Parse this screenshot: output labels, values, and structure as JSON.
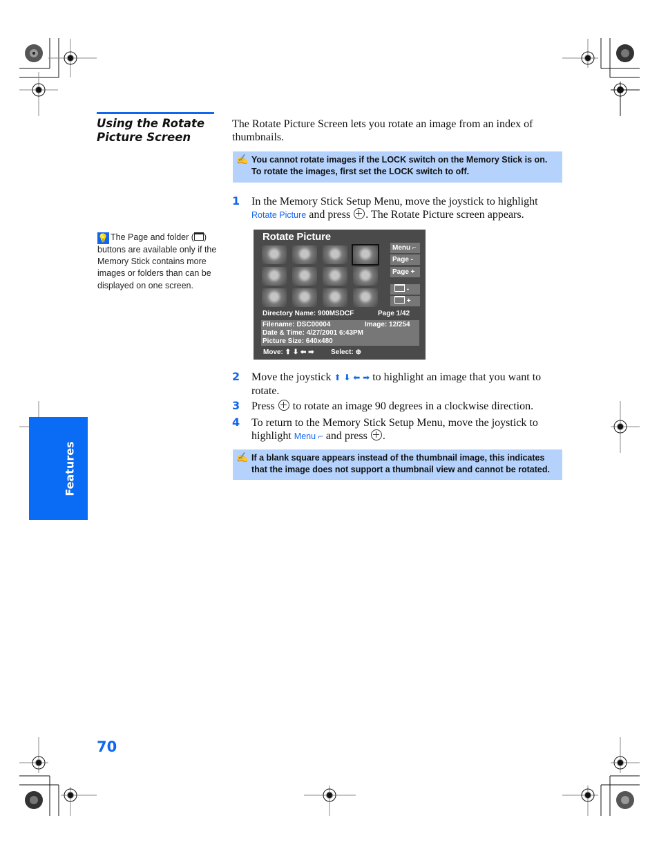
{
  "heading": {
    "line1": "Using the Rotate",
    "line2": "Picture Screen"
  },
  "intro": "The Rotate Picture Screen lets you rotate an image from an index of thumbnails.",
  "notes": [
    {
      "icon": "note-pencil-icon",
      "text": "You cannot rotate images if the LOCK switch on the Memory Stick is on. To rotate the images, first set the LOCK switch to off."
    },
    {
      "icon": "note-pencil-icon",
      "text": "If a blank square appears instead of the thumbnail image, this indicates that the image does not support a thumbnail view and cannot be rotated."
    }
  ],
  "steps": [
    {
      "number": "1",
      "part1": "In the Memory Stick Setup Menu, move the joystick to highlight ",
      "ui_ref": "Rotate Picture",
      "part2": " and press ",
      "part3": ". The Rotate Picture screen appears."
    },
    {
      "number": "2",
      "part1": "Move the joystick ",
      "arrows": "⬆ ⬇ ⬅ ➡",
      "part2": " to highlight an image that you want to rotate."
    },
    {
      "number": "3",
      "part1": "Press ",
      "part2": " to rotate an image 90 degrees in a clockwise direction."
    },
    {
      "number": "4",
      "part1": "To return to the Memory Stick Setup Menu, move the joystick to highlight ",
      "ui_ref": "Menu ⌐",
      "part2": " and press ",
      "part3": "."
    }
  ],
  "tip": {
    "icon": "tip-lightbulb-icon",
    "part1": "The Page and folder (",
    "part2": ") buttons are available only if the Memory Stick contains more images or folders than can be displayed on one screen."
  },
  "screen": {
    "title": "Rotate Picture",
    "thumbnail_count": 12,
    "selected_thumbnail": 4,
    "buttons": {
      "menu": "Menu ⌐",
      "page_minus": "Page -",
      "page_plus": "Page +",
      "folder_minus": "-",
      "folder_plus": "+"
    },
    "directory": "Directory Name: 900MSDCF",
    "page": "Page 1/42",
    "filename": "Filename: DSC00004",
    "image": "Image: 12/254",
    "datetime": "Date & Time: 4/27/2001 6:43PM",
    "picture_size": "Picture Size: 640x480",
    "move": "Move: ⬆ ⬇ ⬅ ➡",
    "select": "Select: ⊕"
  },
  "side_tab": "Features",
  "page_number": "70",
  "colors": {
    "accent": "#1166ee",
    "note_bg": "#b4d2fb",
    "tab_bg": "#0a6cf5",
    "screen_bg": "#4a4a4a"
  }
}
